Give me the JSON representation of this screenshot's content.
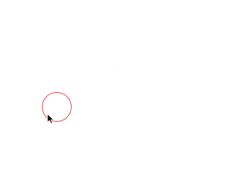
{
  "screen": {
    "background_color": "#ffffff"
  },
  "target": {
    "shape": "circle",
    "stroke_color": "#e0474c"
  },
  "pointer": {
    "icon": "mouse-pointer-icon",
    "color": "#000000"
  }
}
